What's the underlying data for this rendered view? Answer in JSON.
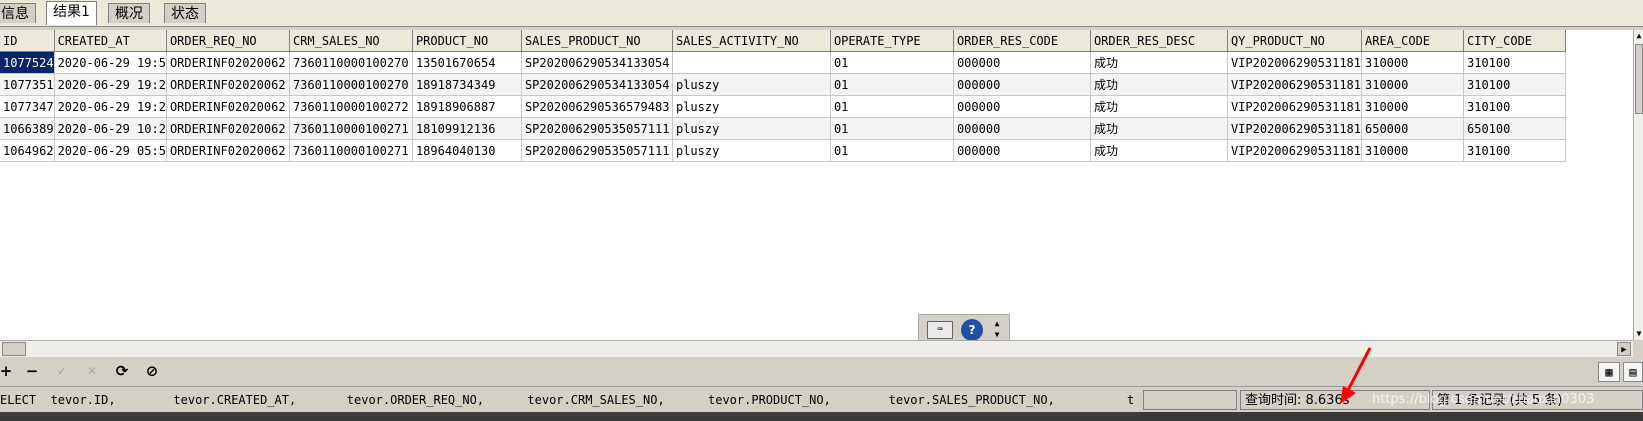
{
  "tabs": [
    {
      "label": "信息"
    },
    {
      "label": "结果1"
    },
    {
      "label": "概况"
    },
    {
      "label": "状态"
    }
  ],
  "table": {
    "columns": [
      "ID",
      "CREATED_AT",
      "ORDER_REQ_NO",
      "CRM_SALES_NO",
      "PRODUCT_NO",
      "SALES_PRODUCT_NO",
      "SALES_ACTIVITY_NO",
      "OPERATE_TYPE",
      "ORDER_RES_CODE",
      "ORDER_RES_DESC",
      "QY_PRODUCT_NO",
      "AREA_CODE",
      "CITY_CODE"
    ],
    "rows": [
      [
        "1077524",
        "2020-06-29 19:5",
        "ORDERINF02020062",
        "7360110000100270",
        "13501670654",
        "SP202006290534133054",
        "",
        "01",
        "000000",
        "成功",
        "VIP202006290531181",
        "310000",
        "310100"
      ],
      [
        "1077351",
        "2020-06-29 19:2",
        "ORDERINF02020062",
        "7360110000100270",
        "18918734349",
        "SP202006290534133054",
        "pluszy",
        "01",
        "000000",
        "成功",
        "VIP202006290531181",
        "310000",
        "310100"
      ],
      [
        "1077347",
        "2020-06-29 19:2",
        "ORDERINF02020062",
        "7360110000100272",
        "18918906887",
        "SP202006290536579483",
        "pluszy",
        "01",
        "000000",
        "成功",
        "VIP202006290531181",
        "310000",
        "310100"
      ],
      [
        "1066389",
        "2020-06-29 10:2",
        "ORDERINF02020062",
        "7360110000100271",
        "18109912136",
        "SP202006290535057111",
        "pluszy",
        "01",
        "000000",
        "成功",
        "VIP202006290531181",
        "650000",
        "650100"
      ],
      [
        "1064962",
        "2020-06-29 05:5",
        "ORDERINF02020062",
        "7360110000100271",
        "18964040130",
        "SP202006290535057111",
        "pluszy",
        "01",
        "000000",
        "成功",
        "VIP202006290531181",
        "310000",
        "310100"
      ]
    ]
  },
  "help": {
    "kbd_icon": "keyboard-icon",
    "help_symbol": "?"
  },
  "toolbar": {
    "add": "+",
    "remove": "−",
    "confirm": "✓",
    "cancel": "✕",
    "refresh": "⟳",
    "stop": "⊘"
  },
  "status": {
    "sql": "ELECT  tevor.ID,        tevor.CREATED_AT,       tevor.ORDER_REQ_NO,      tevor.CRM_SALES_NO,      tevor.PRODUCT_NO,        tevor.SALES_PRODUCT_NO,          t",
    "query_time": "查询时间: 8.636s",
    "records": "第 1 条记录 (共 5 条)",
    "watermark": "https://blog.csdn.net/zhaoxin0303"
  },
  "colors": {
    "selection": "#0a246a",
    "annotation_arrow": "#ff0000"
  }
}
